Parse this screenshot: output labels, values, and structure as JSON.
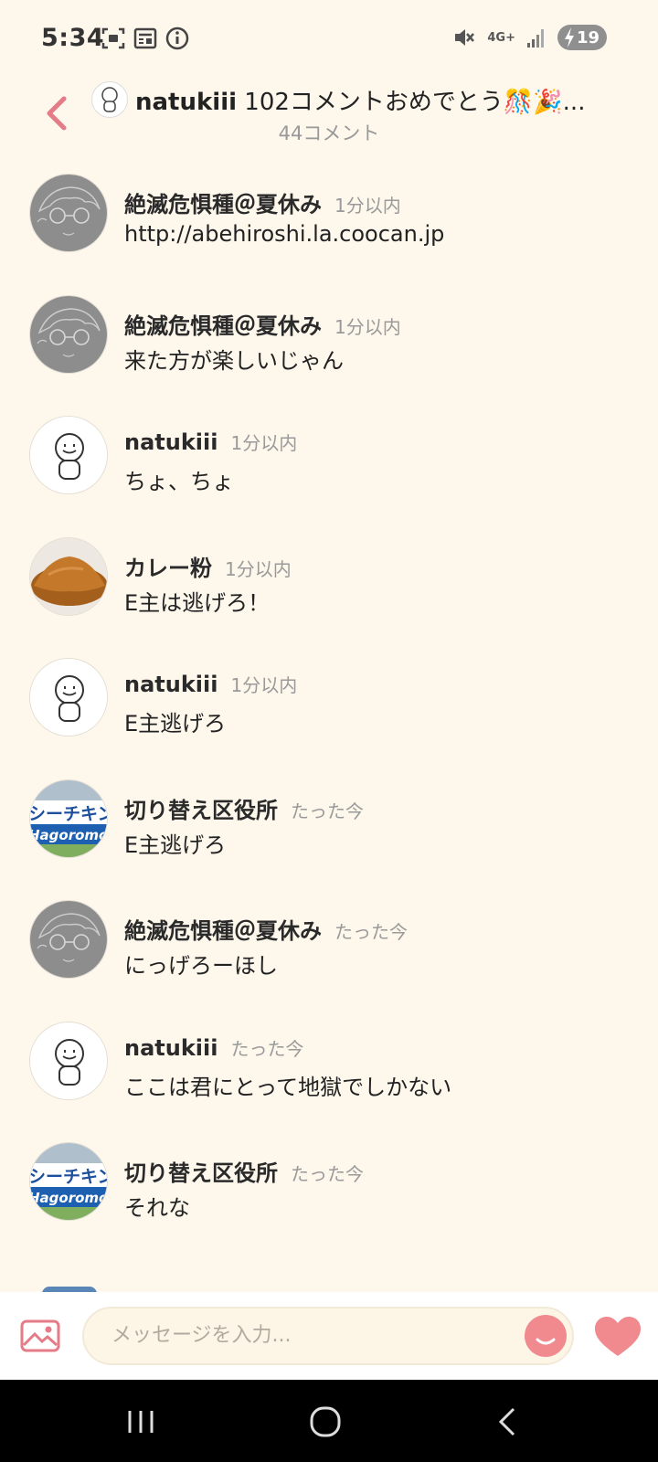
{
  "status_bar": {
    "time": "5:34",
    "network": "4G+",
    "battery": "19"
  },
  "header": {
    "user": "natukiii",
    "title_rest": " 102コメントおめでとう🎊🎉...",
    "comment_count": "44コメント"
  },
  "comments": [
    {
      "name": "絶滅危惧種＠夏休み",
      "time": "1分以内",
      "text": "http://abehiroshi.la.coocan.jp",
      "avatar": "sketch"
    },
    {
      "name": "絶滅危惧種＠夏休み",
      "time": "1分以内",
      "text": "来た方が楽しいじゃん",
      "avatar": "sketch"
    },
    {
      "name": "natukiii",
      "time": "1分以内",
      "text": "ちょ、ちょ",
      "avatar": "default"
    },
    {
      "name": "カレー粉",
      "time": "1分以内",
      "text": "E主は逃げろ！",
      "avatar": "curry"
    },
    {
      "name": "natukiii",
      "time": "1分以内",
      "text": "E主逃げろ",
      "avatar": "default"
    },
    {
      "name": "切り替え区役所",
      "time": "たった今",
      "text": "E主逃げろ",
      "avatar": "tuna"
    },
    {
      "name": "絶滅危惧種＠夏休み",
      "time": "たった今",
      "text": "にっげろーほし",
      "avatar": "sketch"
    },
    {
      "name": "natukiii",
      "time": "たった今",
      "text": "ここは君にとって地獄でしかない",
      "avatar": "default"
    },
    {
      "name": "切り替え区役所",
      "time": "たった今",
      "text": "それな",
      "avatar": "tuna"
    }
  ],
  "avatar_labels": {
    "tuna_top": "シーチキン",
    "tuna_bottom": "Hagoromo"
  },
  "input": {
    "placeholder": "メッセージを入力..."
  },
  "colors": {
    "background": "#fdf7ec",
    "accent": "#f08a8f",
    "back_arrow": "#e47b86"
  }
}
